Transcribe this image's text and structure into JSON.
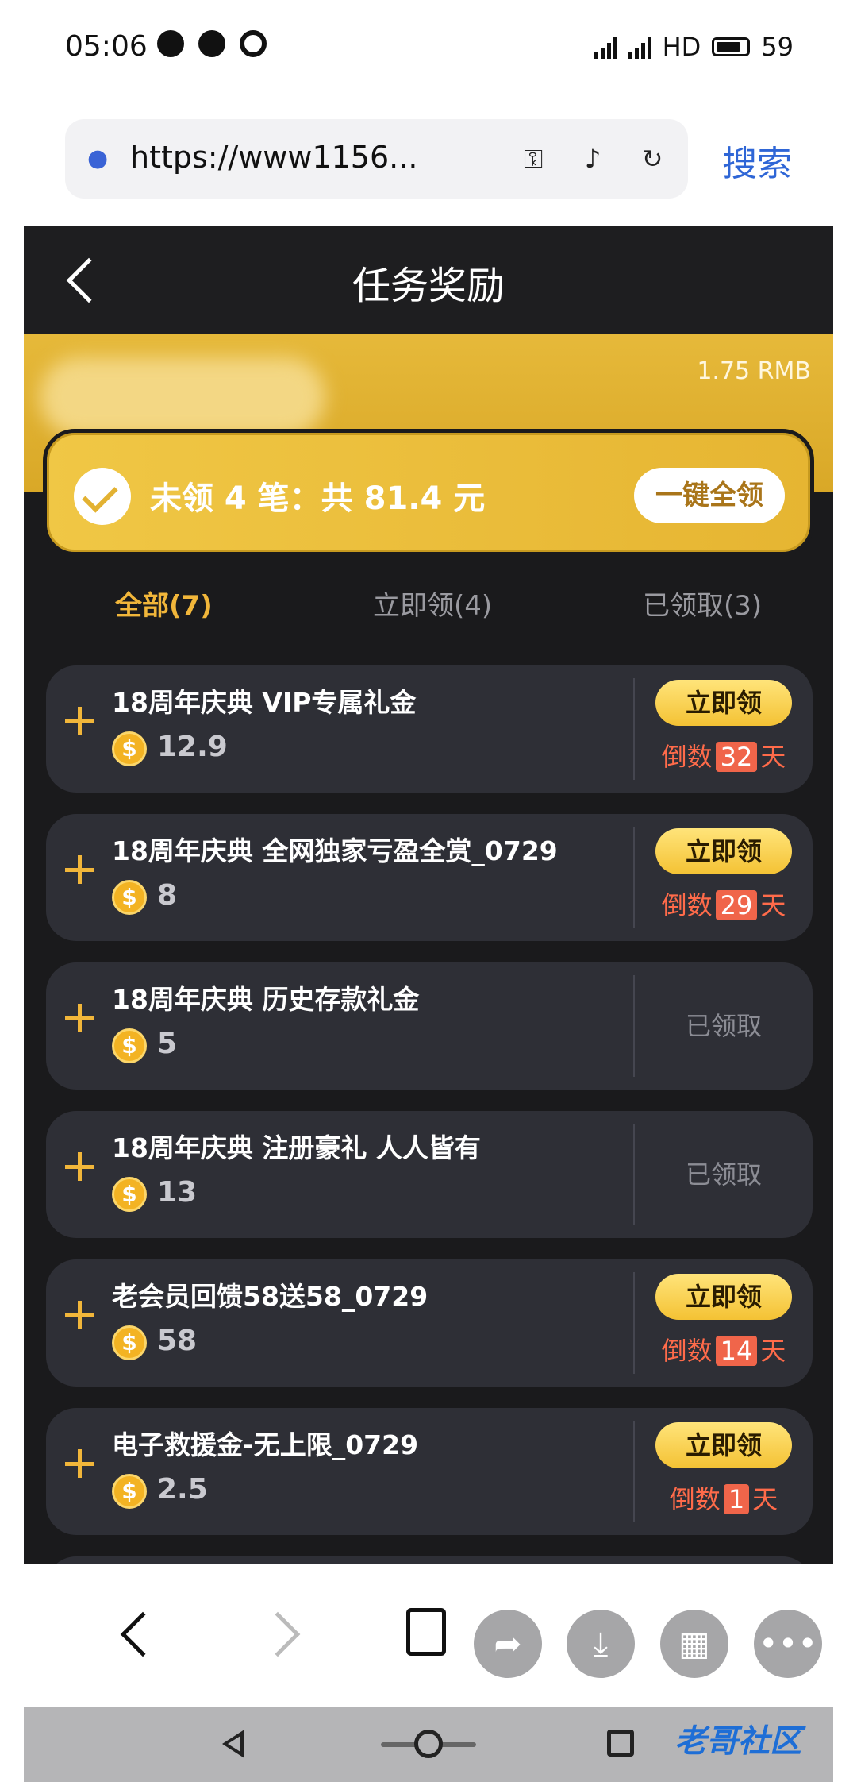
{
  "status_bar": {
    "time": "05:06",
    "network": "HD",
    "battery": "59"
  },
  "browser": {
    "url": "https://www1156...",
    "search_label": "搜索"
  },
  "header": {
    "title": "任务奖励"
  },
  "summary": {
    "balance": "1.75 RMB",
    "unclaimed_text": "未领 4 笔：共 81.4 元",
    "claim_all_label": "一键全领"
  },
  "tabs": [
    {
      "label": "全部(7)",
      "active": true
    },
    {
      "label": "立即领(4)",
      "active": false
    },
    {
      "label": "已领取(3)",
      "active": false
    }
  ],
  "tasks": [
    {
      "title": "18周年庆典 VIP专属礼金",
      "amount": "12.9",
      "status": "claimable",
      "action": "立即领",
      "countdown_prefix": "倒数",
      "days": "32",
      "countdown_suffix": "天"
    },
    {
      "title": "18周年庆典 全网独家亏盈全赏_0729",
      "amount": "8",
      "status": "claimable",
      "action": "立即领",
      "countdown_prefix": "倒数",
      "days": "29",
      "countdown_suffix": "天"
    },
    {
      "title": "18周年庆典 历史存款礼金",
      "amount": "5",
      "status": "received",
      "received_label": "已领取"
    },
    {
      "title": "18周年庆典 注册豪礼 人人皆有",
      "amount": "13",
      "status": "received",
      "received_label": "已领取"
    },
    {
      "title": "老会员回馈58送58_0729",
      "amount": "58",
      "status": "claimable",
      "action": "立即领",
      "countdown_prefix": "倒数",
      "days": "14",
      "countdown_suffix": "天"
    },
    {
      "title": "电子救援金-无上限_0729",
      "amount": "2.5",
      "status": "claimable",
      "action": "立即领",
      "countdown_prefix": "倒数",
      "days": "1",
      "countdown_suffix": "天"
    }
  ],
  "coin_symbol": "$",
  "watermark": "老哥社区",
  "colors": {
    "accent": "#f1b63a",
    "background": "#1a1a1c",
    "card": "#2e2f36",
    "countdown": "#f0654a",
    "search": "#2f66d6"
  }
}
